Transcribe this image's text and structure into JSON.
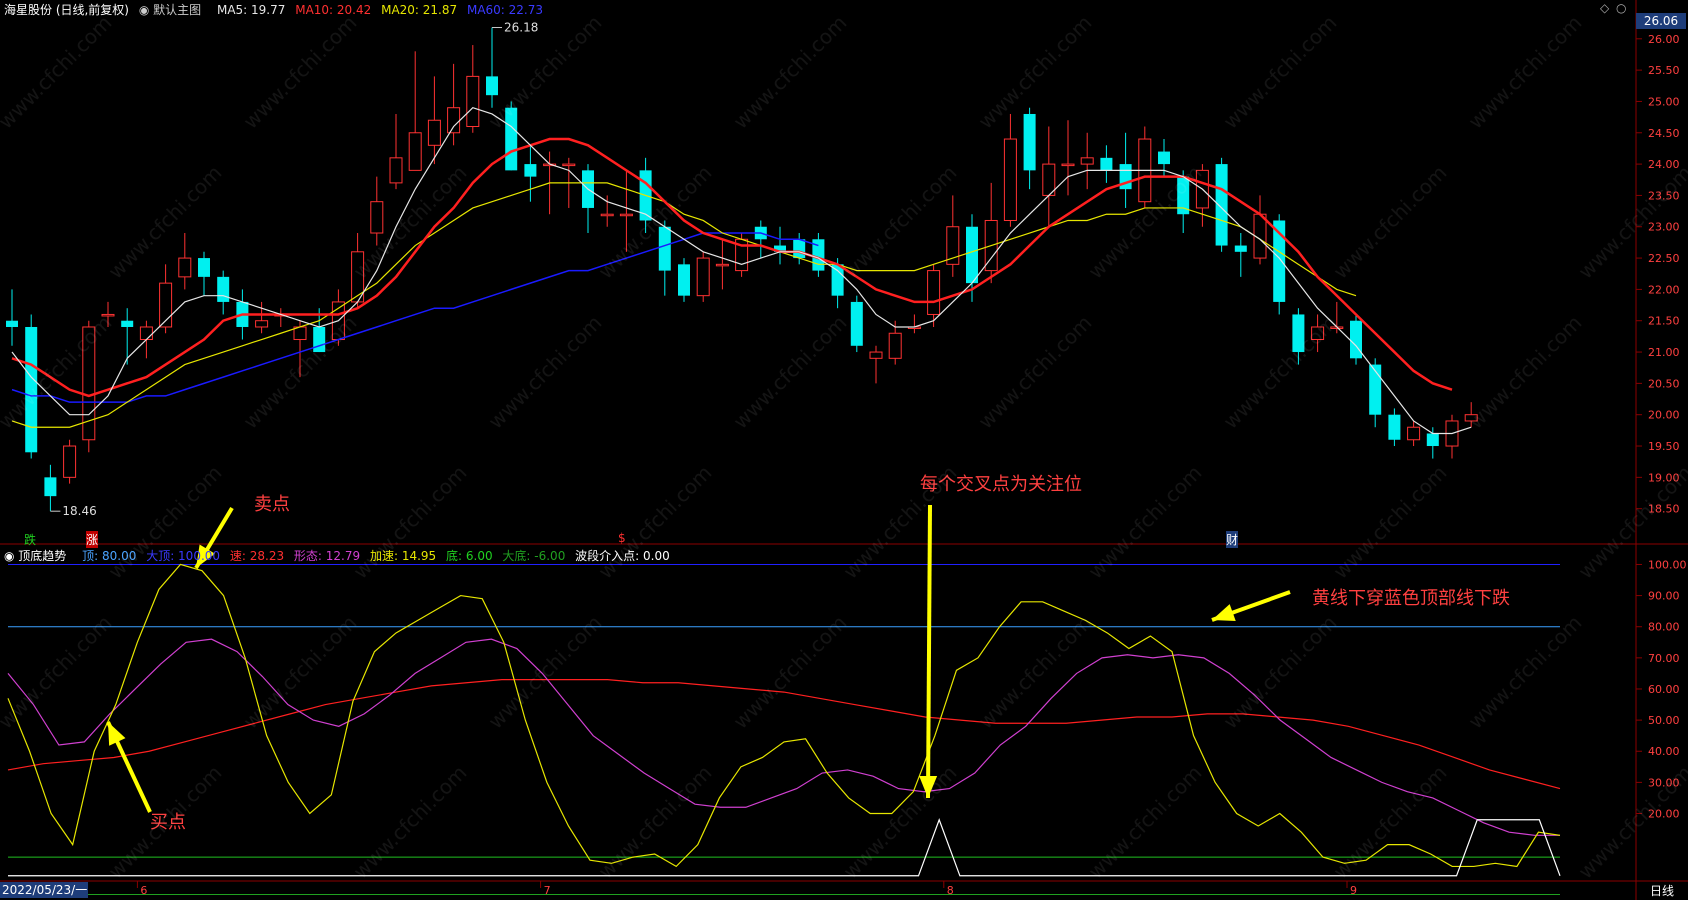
{
  "header": {
    "stock": "海星股份 (日线,前复权)",
    "main_chart": "默认主图",
    "ma5": "MA5: 19.77",
    "ma10": "MA10: 20.42",
    "ma20": "MA20: 21.87",
    "ma60": "MA60: 22.73",
    "current_price": "26.06"
  },
  "indicator_header": {
    "name": "顶底趋势",
    "top": "顶: 80.00",
    "big_top": "大顶: 100.00",
    "speed": "速: 28.23",
    "shape": "形态: 12.79",
    "accel": "加速: 14.95",
    "bottom": "底: 6.00",
    "big_bottom": "大底: -6.00",
    "entry": "波段介入点: 0.00"
  },
  "annotations": {
    "sell": "卖点",
    "buy": "买点",
    "cross": "每个交叉点为关注位",
    "yellow_cross": "黄线下穿蓝色顶部线下跌"
  },
  "markers": {
    "down": "跌",
    "up": "涨",
    "s": "$",
    "cai": "财"
  },
  "footer": {
    "date": "2022/05/23/一",
    "period": "日线"
  },
  "watermark": "www.cfchi.com",
  "colors": {
    "up": "#ff3232",
    "down": "#00f0f0",
    "ma5": "#e6e6e6",
    "ma10": "#ff2020",
    "ma20": "#e6e600",
    "ma60": "#1a1aff"
  },
  "chart_data": [
    {
      "type": "candlestick",
      "ylim": [
        18.0,
        26.3
      ],
      "y_ticks": [
        18.5,
        19.0,
        19.5,
        20.0,
        20.5,
        21.0,
        21.5,
        22.0,
        22.5,
        23.0,
        23.5,
        24.0,
        24.5,
        25.0,
        25.5,
        26.0
      ],
      "x_ticks": [
        "6",
        "7",
        "8",
        "9"
      ],
      "labels": {
        "high": "26.18",
        "low": "18.46"
      },
      "candles": [
        [
          21.5,
          21.4,
          22.0,
          21.1
        ],
        [
          21.4,
          19.4,
          21.6,
          19.3
        ],
        [
          19.0,
          18.7,
          19.2,
          18.46
        ],
        [
          19.0,
          19.5,
          19.6,
          18.9
        ],
        [
          19.6,
          21.4,
          21.5,
          19.4
        ],
        [
          21.6,
          21.6,
          21.8,
          21.4
        ],
        [
          21.5,
          21.4,
          21.7,
          20.8
        ],
        [
          21.2,
          21.4,
          21.5,
          20.9
        ],
        [
          21.4,
          22.1,
          22.4,
          21.3
        ],
        [
          22.2,
          22.5,
          22.9,
          22.0
        ],
        [
          22.5,
          22.2,
          22.6,
          21.9
        ],
        [
          22.2,
          21.8,
          22.3,
          21.6
        ],
        [
          21.8,
          21.4,
          22.0,
          21.2
        ],
        [
          21.4,
          21.5,
          21.8,
          21.3
        ],
        [
          21.6,
          21.6,
          21.7,
          21.4
        ],
        [
          21.2,
          21.4,
          21.5,
          20.6
        ],
        [
          21.4,
          21.0,
          21.7,
          21.0
        ],
        [
          21.2,
          21.8,
          22.0,
          21.1
        ],
        [
          21.8,
          22.6,
          22.9,
          21.7
        ],
        [
          22.9,
          23.4,
          23.8,
          22.7
        ],
        [
          23.7,
          24.1,
          24.8,
          23.6
        ],
        [
          23.9,
          24.5,
          25.8,
          23.9
        ],
        [
          24.3,
          24.7,
          25.4,
          24.0
        ],
        [
          24.5,
          24.9,
          25.6,
          24.3
        ],
        [
          24.6,
          25.4,
          25.9,
          24.5
        ],
        [
          25.4,
          25.1,
          26.18,
          24.9
        ],
        [
          24.9,
          23.9,
          25.0,
          23.9
        ],
        [
          24.0,
          23.8,
          24.3,
          23.4
        ],
        [
          24.0,
          24.0,
          24.2,
          23.2
        ],
        [
          24.0,
          24.0,
          24.1,
          23.3
        ],
        [
          23.9,
          23.3,
          24.0,
          22.9
        ],
        [
          23.2,
          23.2,
          23.5,
          23.0
        ],
        [
          23.2,
          23.2,
          23.9,
          22.6
        ],
        [
          23.9,
          23.1,
          24.1,
          22.9
        ],
        [
          23.0,
          22.3,
          23.1,
          21.9
        ],
        [
          22.4,
          21.9,
          22.5,
          21.8
        ],
        [
          21.9,
          22.5,
          22.6,
          21.8
        ],
        [
          22.4,
          22.4,
          22.8,
          22.0
        ],
        [
          22.3,
          22.8,
          22.9,
          22.2
        ],
        [
          23.0,
          22.8,
          23.1,
          22.5
        ],
        [
          22.7,
          22.6,
          23.0,
          22.4
        ],
        [
          22.8,
          22.5,
          22.9,
          22.4
        ],
        [
          22.8,
          22.3,
          22.9,
          22.2
        ],
        [
          22.4,
          21.9,
          22.5,
          21.7
        ],
        [
          21.8,
          21.1,
          21.9,
          21.0
        ],
        [
          20.9,
          21.0,
          21.1,
          20.5
        ],
        [
          20.9,
          21.3,
          21.5,
          20.8
        ],
        [
          21.4,
          21.4,
          21.6,
          21.3
        ],
        [
          21.6,
          22.3,
          22.4,
          21.4
        ],
        [
          22.4,
          23.0,
          23.5,
          22.2
        ],
        [
          23.0,
          22.1,
          23.2,
          21.8
        ],
        [
          22.3,
          23.1,
          23.7,
          22.1
        ],
        [
          23.1,
          24.4,
          24.8,
          23.0
        ],
        [
          24.8,
          23.9,
          24.9,
          23.6
        ],
        [
          23.5,
          24.0,
          24.6,
          23.0
        ],
        [
          24.0,
          24.0,
          24.7,
          23.5
        ],
        [
          24.0,
          24.1,
          24.5,
          23.6
        ],
        [
          24.1,
          23.9,
          24.3,
          23.7
        ],
        [
          24.0,
          23.6,
          24.5,
          23.3
        ],
        [
          23.4,
          24.4,
          24.6,
          23.3
        ],
        [
          24.2,
          24.0,
          24.4,
          23.8
        ],
        [
          23.8,
          23.2,
          23.9,
          22.9
        ],
        [
          23.3,
          23.9,
          24.0,
          23.0
        ],
        [
          24.0,
          22.7,
          24.1,
          22.6
        ],
        [
          22.7,
          22.6,
          22.9,
          22.2
        ],
        [
          22.5,
          23.2,
          23.5,
          22.4
        ],
        [
          23.1,
          21.8,
          23.2,
          21.6
        ],
        [
          21.6,
          21.0,
          21.7,
          20.8
        ],
        [
          21.2,
          21.4,
          21.6,
          21.0
        ],
        [
          21.4,
          21.4,
          21.8,
          21.3
        ],
        [
          21.5,
          20.9,
          21.6,
          20.8
        ],
        [
          20.8,
          20.0,
          20.9,
          19.8
        ],
        [
          20.0,
          19.6,
          20.1,
          19.5
        ],
        [
          19.6,
          19.8,
          19.9,
          19.5
        ],
        [
          19.7,
          19.5,
          19.8,
          19.3
        ],
        [
          19.5,
          19.9,
          20.0,
          19.3
        ],
        [
          19.9,
          20.0,
          20.2,
          19.8
        ]
      ],
      "ma5": [
        21.0,
        20.6,
        20.3,
        20.0,
        20.0,
        20.3,
        20.9,
        21.2,
        21.5,
        21.8,
        21.9,
        21.9,
        21.8,
        21.7,
        21.6,
        21.5,
        21.4,
        21.5,
        21.8,
        22.3,
        23.0,
        23.6,
        24.1,
        24.6,
        24.9,
        24.8,
        24.6,
        24.3,
        24.0,
        23.9,
        23.6,
        23.4,
        23.3,
        23.2,
        23.0,
        22.8,
        22.6,
        22.5,
        22.4,
        22.5,
        22.6,
        22.6,
        22.5,
        22.3,
        22.0,
        21.6,
        21.4,
        21.4,
        21.5,
        21.8,
        22.1,
        22.5,
        22.9,
        23.2,
        23.5,
        23.8,
        23.9,
        23.9,
        23.9,
        23.9,
        23.9,
        23.8,
        23.6,
        23.3,
        23.0,
        22.8,
        22.5,
        22.1,
        21.7,
        21.4,
        21.1,
        20.7,
        20.3,
        19.9,
        19.7,
        19.7,
        19.8
      ],
      "ma10": [
        20.9,
        20.8,
        20.6,
        20.4,
        20.3,
        20.4,
        20.5,
        20.6,
        20.8,
        21.0,
        21.2,
        21.5,
        21.6,
        21.6,
        21.6,
        21.6,
        21.6,
        21.6,
        21.7,
        21.9,
        22.2,
        22.6,
        23.0,
        23.3,
        23.7,
        24.0,
        24.2,
        24.3,
        24.4,
        24.4,
        24.3,
        24.1,
        23.9,
        23.7,
        23.4,
        23.1,
        22.9,
        22.8,
        22.7,
        22.7,
        22.6,
        22.6,
        22.5,
        22.4,
        22.2,
        22.0,
        21.9,
        21.8,
        21.8,
        21.9,
        22.0,
        22.2,
        22.4,
        22.7,
        23.0,
        23.2,
        23.4,
        23.6,
        23.7,
        23.8,
        23.8,
        23.8,
        23.7,
        23.6,
        23.4,
        23.2,
        22.9,
        22.6,
        22.2,
        21.9,
        21.6,
        21.3,
        21.0,
        20.7,
        20.5,
        20.4
      ],
      "ma20": [
        19.9,
        19.8,
        19.8,
        19.8,
        19.9,
        20.0,
        20.2,
        20.4,
        20.6,
        20.8,
        20.9,
        21.0,
        21.1,
        21.2,
        21.3,
        21.4,
        21.5,
        21.7,
        21.9,
        22.1,
        22.4,
        22.7,
        22.9,
        23.1,
        23.3,
        23.4,
        23.5,
        23.6,
        23.7,
        23.7,
        23.7,
        23.7,
        23.6,
        23.5,
        23.4,
        23.2,
        23.1,
        22.9,
        22.8,
        22.7,
        22.6,
        22.5,
        22.4,
        22.4,
        22.3,
        22.3,
        22.3,
        22.3,
        22.4,
        22.5,
        22.6,
        22.7,
        22.8,
        22.9,
        23.0,
        23.1,
        23.1,
        23.2,
        23.2,
        23.3,
        23.3,
        23.3,
        23.2,
        23.1,
        23.0,
        22.8,
        22.6,
        22.4,
        22.2,
        22.0,
        21.9
      ],
      "ma60": [
        20.4,
        20.3,
        20.3,
        20.2,
        20.2,
        20.2,
        20.2,
        20.3,
        20.3,
        20.4,
        20.5,
        20.6,
        20.7,
        20.8,
        20.9,
        21.0,
        21.1,
        21.2,
        21.3,
        21.4,
        21.5,
        21.6,
        21.7,
        21.7,
        21.8,
        21.9,
        22.0,
        22.1,
        22.2,
        22.3,
        22.3,
        22.4,
        22.5,
        22.6,
        22.7,
        22.8,
        22.9,
        22.9,
        22.9,
        22.9,
        22.8,
        22.8,
        22.7
      ]
    },
    {
      "type": "line",
      "ylim": [
        -2,
        104
      ],
      "y_ticks": [
        20,
        30,
        40,
        50,
        60,
        70,
        80,
        90,
        100
      ],
      "levels": [
        100,
        80,
        6,
        -6
      ],
      "series": [
        {
          "name": "速",
          "color": "#ff2020",
          "values": [
            34,
            36,
            37,
            38,
            40,
            43,
            46,
            49,
            52,
            55,
            57,
            59,
            61,
            62,
            63,
            63,
            63,
            63,
            62,
            62,
            61,
            60,
            59,
            57,
            55,
            53,
            51,
            50,
            49,
            49,
            49,
            50,
            51,
            51,
            52,
            52,
            51,
            50,
            48,
            45,
            42,
            38,
            34,
            31,
            28
          ]
        },
        {
          "name": "形态",
          "color": "#d040d0",
          "values": [
            65,
            55,
            42,
            43,
            52,
            60,
            68,
            75,
            76,
            72,
            64,
            55,
            50,
            48,
            52,
            58,
            65,
            70,
            75,
            76,
            73,
            65,
            55,
            45,
            39,
            33,
            28,
            23,
            22,
            22,
            25,
            28,
            33,
            34,
            32,
            28,
            27,
            28,
            33,
            42,
            48,
            57,
            65,
            70,
            71,
            70,
            71,
            70,
            65,
            58,
            50,
            44,
            38,
            34,
            30,
            27,
            25,
            21,
            17,
            14,
            13,
            13
          ]
        },
        {
          "name": "加速",
          "color": "#e6e600",
          "values": [
            57,
            40,
            20,
            10,
            40,
            55,
            75,
            92,
            100,
            98,
            90,
            70,
            45,
            30,
            20,
            26,
            56,
            72,
            78,
            82,
            86,
            90,
            89,
            75,
            50,
            30,
            16,
            5,
            4,
            6,
            7,
            3,
            10,
            25,
            35,
            38,
            43,
            44,
            33,
            25,
            20,
            20,
            27,
            45,
            66,
            70,
            80,
            88,
            88,
            85,
            82,
            78,
            73,
            77,
            72,
            45,
            30,
            20,
            16,
            20,
            14,
            6,
            4,
            5,
            10,
            10,
            7,
            3,
            3,
            4,
            3,
            14,
            13
          ]
        },
        {
          "name": "波段介入点",
          "color": "#ffffff",
          "values": [
            0,
            0,
            0,
            0,
            0,
            0,
            0,
            0,
            0,
            0,
            0,
            0,
            0,
            0,
            0,
            0,
            0,
            0,
            0,
            0,
            0,
            0,
            0,
            0,
            0,
            0,
            0,
            0,
            0,
            0,
            0,
            0,
            0,
            0,
            0,
            0,
            0,
            0,
            0,
            0,
            0,
            0,
            0,
            0,
            0,
            18,
            0,
            0,
            0,
            0,
            0,
            0,
            0,
            0,
            0,
            0,
            0,
            0,
            0,
            0,
            0,
            0,
            0,
            0,
            0,
            0,
            0,
            0,
            0,
            0,
            0,
            18,
            18,
            18,
            18,
            0
          ]
        }
      ]
    }
  ]
}
